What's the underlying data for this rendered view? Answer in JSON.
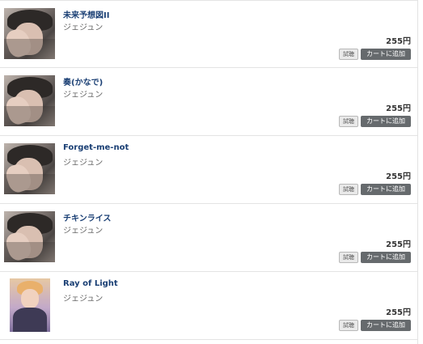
{
  "tracks": [
    {
      "title": "未来予想図II",
      "artist": "ジェジュン",
      "price": "255円",
      "try_label": "試聴",
      "cart_label": "カートに追加"
    },
    {
      "title": "奏(かなで)",
      "artist": "ジェジュン",
      "price": "255円",
      "try_label": "試聴",
      "cart_label": "カートに追加"
    },
    {
      "title": "Forget-me-not",
      "artist": "ジェジュン",
      "price": "255円",
      "try_label": "試聴",
      "cart_label": "カートに追加"
    },
    {
      "title": "チキンライス",
      "artist": "ジェジュン",
      "price": "255円",
      "try_label": "試聴",
      "cart_label": "カートに追加"
    },
    {
      "title": "Ray of Light",
      "artist": "ジェジュン",
      "price": "255円",
      "try_label": "試聴",
      "cart_label": "カートに追加"
    }
  ],
  "colors": {
    "title": "#1a3f74",
    "cart_button": "#666a6d"
  }
}
